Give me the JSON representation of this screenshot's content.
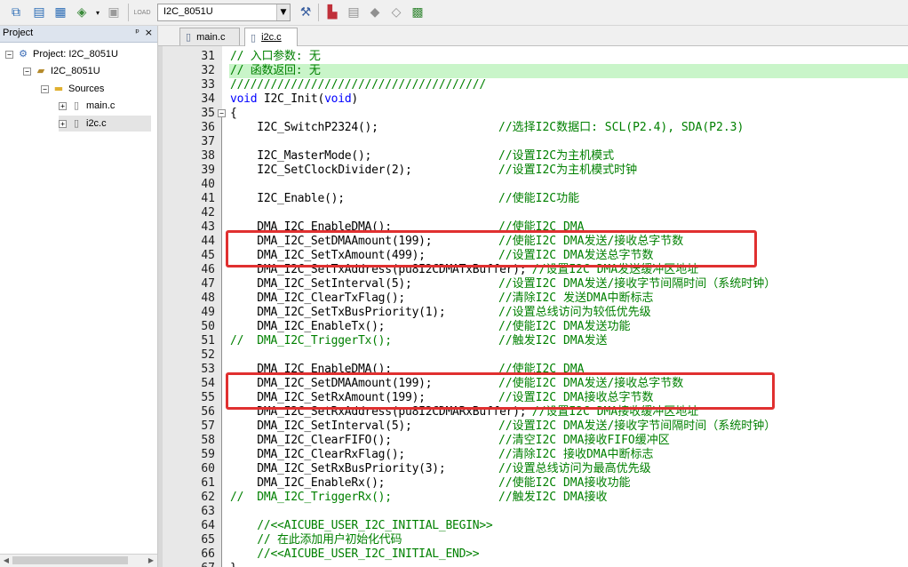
{
  "toolbar": {
    "target_name": "I2C_8051U",
    "icons": [
      "translate-icon",
      "build-icon",
      "rebuild-icon",
      "batch-build-icon",
      "stop-build-icon",
      "download-icon",
      "target-options-icon",
      "manage-components-icon",
      "pack-installer-icon",
      "select-packs-icon",
      "runtime-env-icon",
      "event-recorder-icon"
    ],
    "load_label": "LOAD"
  },
  "project_panel": {
    "title": "Project",
    "pin_glyph": "ᵖ",
    "close_glyph": "×",
    "tree": [
      {
        "label": "Project: I2C_8051U",
        "expander": "−",
        "icon": "project-icon"
      },
      {
        "label": "I2C_8051U",
        "expander": "−",
        "icon": "target-icon"
      },
      {
        "label": "Sources",
        "expander": "−",
        "icon": "folder-icon"
      },
      {
        "label": "main.c",
        "expander": "+",
        "icon": "file-icon"
      },
      {
        "label": "i2c.c",
        "expander": "+",
        "icon": "file-icon"
      }
    ]
  },
  "tabs": [
    {
      "label": "main.c",
      "active": false
    },
    {
      "label": "i2c.c",
      "active": true
    }
  ],
  "editor": {
    "highlight_line_index": 1,
    "lines": [
      {
        "num": "31",
        "code": "// 入口参数: 无",
        "kind": "comment-full"
      },
      {
        "num": "32",
        "code": "// 函数返回: 无",
        "kind": "comment-full"
      },
      {
        "num": "33",
        "code": "//////////////////////////////////////",
        "kind": "comment-full"
      },
      {
        "num": "34",
        "code": "void I2C_Init(void)",
        "kind": "decl"
      },
      {
        "num": "35",
        "code": "{",
        "kind": "code",
        "fold": "−"
      },
      {
        "num": "36",
        "code": "    I2C_SwitchP2324();",
        "comment": "//选择I2C数据口: SCL(P2.4), SDA(P2.3)"
      },
      {
        "num": "37",
        "code": ""
      },
      {
        "num": "38",
        "code": "    I2C_MasterMode();",
        "comment": "//设置I2C为主机模式"
      },
      {
        "num": "39",
        "code": "    I2C_SetClockDivider(2);",
        "comment": "//设置I2C为主机模式时钟"
      },
      {
        "num": "40",
        "code": ""
      },
      {
        "num": "41",
        "code": "    I2C_Enable();",
        "comment": "//使能I2C功能"
      },
      {
        "num": "42",
        "code": ""
      },
      {
        "num": "43",
        "code": "    DMA_I2C_EnableDMA();",
        "comment": "//使能I2C DMA"
      },
      {
        "num": "44",
        "code": "    DMA_I2C_SetDMAAmount(199);",
        "comment": "//使能I2C DMA发送/接收总字节数"
      },
      {
        "num": "45",
        "code": "    DMA_I2C_SetTxAmount(499);",
        "comment": "//设置I2C DMA发送总字节数"
      },
      {
        "num": "46",
        "code": "    DMA_I2C_SetTxAddress(pu8I2CDMATxBuffer);",
        "comment": "//设置I2C DMA发送缓冲区地址",
        "comment_col": 45
      },
      {
        "num": "47",
        "code": "    DMA_I2C_SetInterval(5);",
        "comment": "//设置I2C DMA发送/接收字节间隔时间（系统时钟）"
      },
      {
        "num": "48",
        "code": "    DMA_I2C_ClearTxFlag();",
        "comment": "//清除I2C 发送DMA中断标志"
      },
      {
        "num": "49",
        "code": "    DMA_I2C_SetTxBusPriority(1);",
        "comment": "//设置总线访问为较低优先级"
      },
      {
        "num": "50",
        "code": "    DMA_I2C_EnableTx();",
        "comment": "//使能I2C DMA发送功能"
      },
      {
        "num": "51",
        "code": "//  DMA_I2C_TriggerTx();",
        "comment": "//触发I2C DMA发送",
        "kind": "comment-full"
      },
      {
        "num": "52",
        "code": ""
      },
      {
        "num": "53",
        "code": "    DMA_I2C_EnableDMA();",
        "comment": "//使能I2C DMA"
      },
      {
        "num": "54",
        "code": "    DMA_I2C_SetDMAAmount(199);",
        "comment": "//使能I2C DMA发送/接收总字节数"
      },
      {
        "num": "55",
        "code": "    DMA_I2C_SetRxAmount(199);",
        "comment": "//设置I2C DMA接收总字节数"
      },
      {
        "num": "56",
        "code": "    DMA_I2C_SetRxAddress(pu8I2CDMARxBuffer);",
        "comment": "//设置I2C DMA接收缓冲区地址",
        "comment_col": 45
      },
      {
        "num": "57",
        "code": "    DMA_I2C_SetInterval(5);",
        "comment": "//设置I2C DMA发送/接收字节间隔时间（系统时钟）"
      },
      {
        "num": "58",
        "code": "    DMA_I2C_ClearFIFO();",
        "comment": "//清空I2C DMA接收FIFO缓冲区"
      },
      {
        "num": "59",
        "code": "    DMA_I2C_ClearRxFlag();",
        "comment": "//清除I2C 接收DMA中断标志"
      },
      {
        "num": "60",
        "code": "    DMA_I2C_SetRxBusPriority(3);",
        "comment": "//设置总线访问为最高优先级"
      },
      {
        "num": "61",
        "code": "    DMA_I2C_EnableRx();",
        "comment": "//使能I2C DMA接收功能"
      },
      {
        "num": "62",
        "code": "//  DMA_I2C_TriggerRx();",
        "comment": "//触发I2C DMA接收",
        "kind": "comment-full"
      },
      {
        "num": "63",
        "code": ""
      },
      {
        "num": "64",
        "code": "    //<<AICUBE_USER_I2C_INITIAL_BEGIN>>",
        "kind": "comment-full"
      },
      {
        "num": "65",
        "code": "    // 在此添加用户初始化代码",
        "kind": "comment-full"
      },
      {
        "num": "66",
        "code": "    //<<AICUBE_USER_I2C_INITIAL_END>>",
        "kind": "comment-full"
      },
      {
        "num": "67",
        "code": "}",
        "kind": "code"
      }
    ],
    "annotation_boxes": [
      {
        "start_line": "44",
        "end_line": "45",
        "color": "#e03030"
      },
      {
        "start_line": "54",
        "end_line": "55",
        "color": "#e03030"
      }
    ]
  },
  "colors": {
    "comment": "#008000",
    "keyword": "#0000ff",
    "highlight": "#c9f5c9",
    "annotation": "#e03030"
  }
}
